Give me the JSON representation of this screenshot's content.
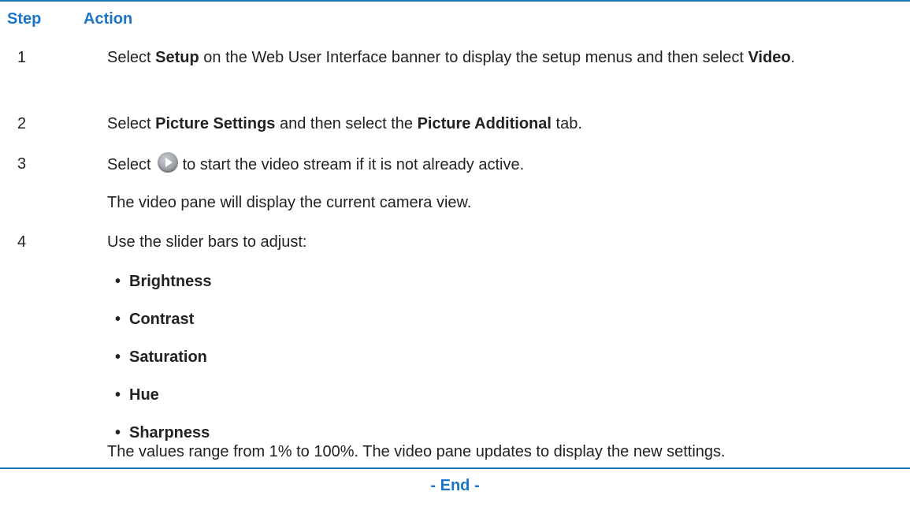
{
  "table": {
    "headers": [
      "Step",
      "Action"
    ],
    "steps": [
      {
        "num": "1",
        "text": [
          "Select ",
          "Setup",
          " on the Web User Interface banner to display the setup menus and then select ",
          "Video",
          "."
        ]
      },
      {
        "num": "2",
        "text": [
          "Select ",
          "Picture Settings",
          " and then select the ",
          "Picture Additional",
          " tab."
        ]
      },
      {
        "num": "3",
        "before_icon": "Select",
        "icon": "play-button-icon",
        "after_icon": "to start the video stream if it is not already active.",
        "note": "The video pane will display the current camera view."
      },
      {
        "num": "4",
        "intro": "Use the slider bars to adjust:",
        "bullets": [
          "Brightness",
          "Contrast",
          "Saturation",
          "Hue",
          "Sharpness"
        ],
        "note": "The values range from 1% to 100%. The video pane updates to display the new settings."
      }
    ]
  },
  "footer": {
    "end_label": "- End -"
  },
  "colors": {
    "accent": "#1b74c5",
    "rule": "#1a76b8",
    "text": "#222222"
  }
}
